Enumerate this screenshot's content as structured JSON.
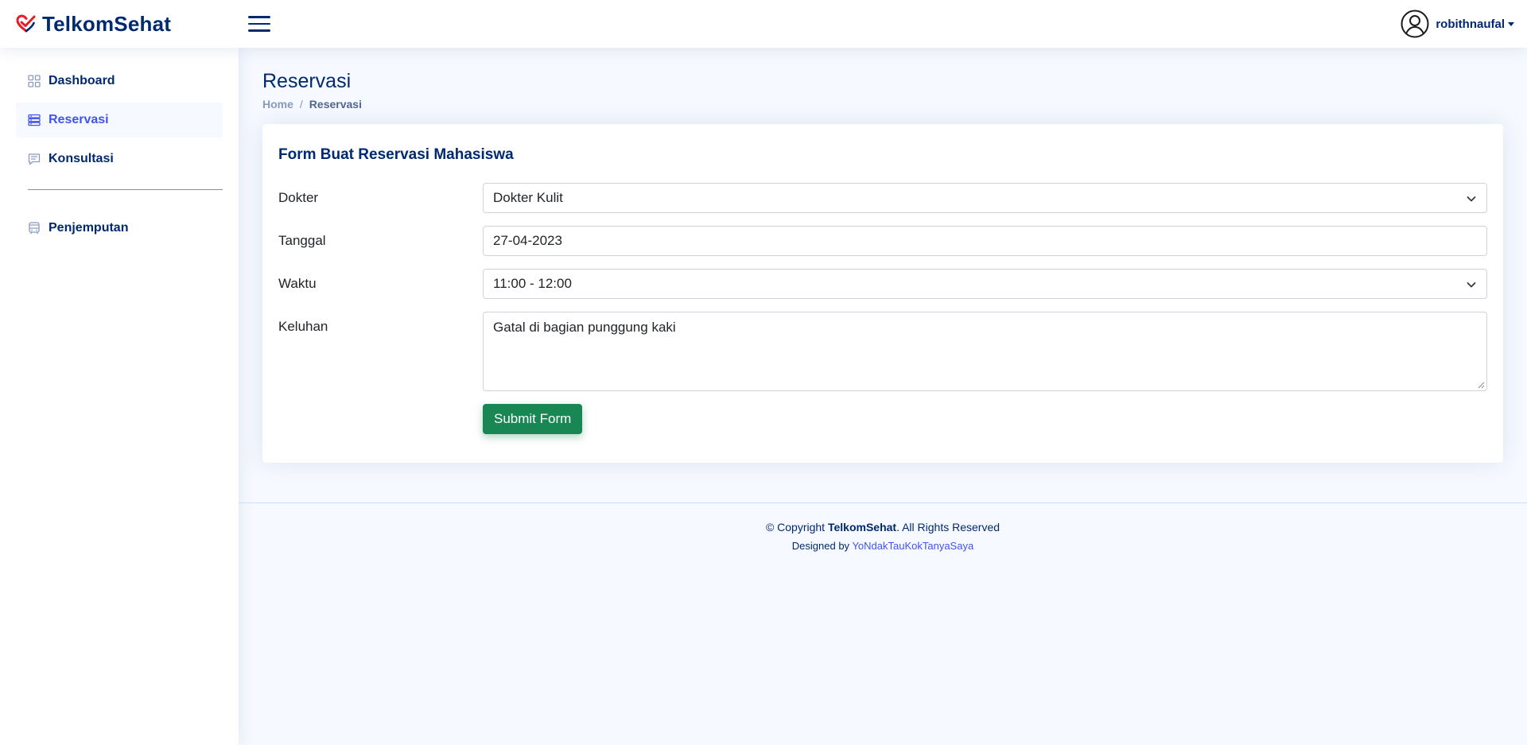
{
  "header": {
    "brand": "TelkomSehat",
    "username": "robithnaufal"
  },
  "sidebar": {
    "items": [
      {
        "label": "Dashboard",
        "icon": "grid-icon"
      },
      {
        "label": "Reservasi",
        "icon": "list-icon"
      },
      {
        "label": "Konsultasi",
        "icon": "chat-icon"
      },
      {
        "label": "Penjemputan",
        "icon": "bus-icon"
      }
    ]
  },
  "page": {
    "title": "Reservasi",
    "breadcrumb": {
      "home": "Home",
      "separator": "/",
      "current": "Reservasi"
    }
  },
  "form": {
    "title": "Form Buat Reservasi Mahasiswa",
    "dokter": {
      "label": "Dokter",
      "value": "Dokter Kulit"
    },
    "tanggal": {
      "label": "Tanggal",
      "value": "27-04-2023"
    },
    "waktu": {
      "label": "Waktu",
      "value": "11:00 - 12:00"
    },
    "keluhan": {
      "label": "Keluhan",
      "value": "Gatal di bagian punggung kaki"
    },
    "submit_label": "Submit Form"
  },
  "footer": {
    "copy_prefix": "© Copyright",
    "brand": "TelkomSehat",
    "copy_suffix": ". All Rights Reserved",
    "designed_prefix": "Designed by",
    "designer": "YoNdakTauKokTanyaSaya"
  },
  "colors": {
    "primary": "#012970",
    "accent": "#4154f1",
    "success": "#198754",
    "background": "#f6f9ff"
  }
}
